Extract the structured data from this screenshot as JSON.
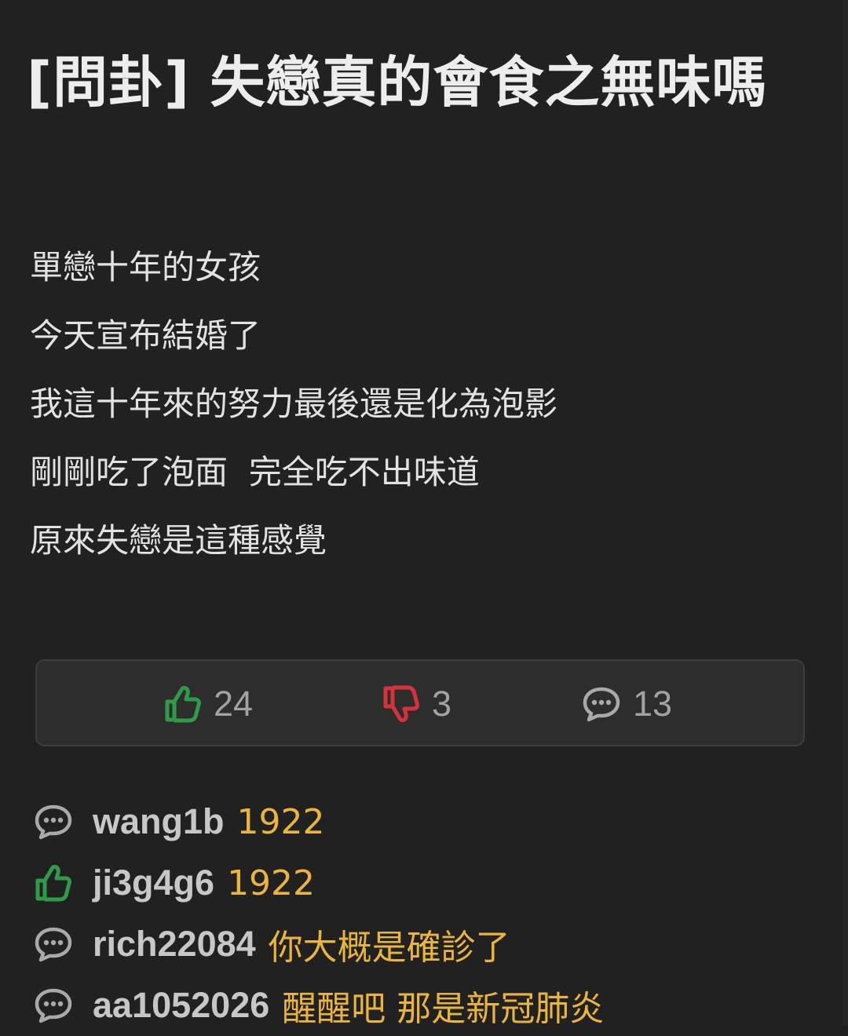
{
  "post": {
    "title": "[問卦] 失戀真的會食之無味嗎",
    "body": [
      "單戀十年的女孩",
      "今天宣布結婚了",
      "我這十年來的努力最後還是化為泡影",
      "剛剛吃了泡面  完全吃不出味道",
      "原來失戀是這種感覺"
    ]
  },
  "stats": {
    "likes": "24",
    "dislikes": "3",
    "comments": "13",
    "like_icon": "thumbs-up-icon",
    "dislike_icon": "thumbs-down-icon",
    "comment_icon": "speech-bubble-icon"
  },
  "comments": [
    {
      "icon": "speech-bubble-icon",
      "user": "wang1b",
      "text": "1922"
    },
    {
      "icon": "thumbs-up-icon",
      "user": "ji3g4g6",
      "text": "1922"
    },
    {
      "icon": "speech-bubble-icon",
      "user": "rich22084",
      "text": "你大概是確診了"
    },
    {
      "icon": "speech-bubble-icon",
      "user": "aa1052026",
      "text": "醒醒吧 那是新冠肺炎"
    }
  ],
  "colors": {
    "background": "#212121",
    "like": "#2f9a47",
    "dislike": "#d6313c",
    "comment_text": "#e9b53e",
    "username": "#c7c7c7",
    "count": "#a2a2a2"
  }
}
